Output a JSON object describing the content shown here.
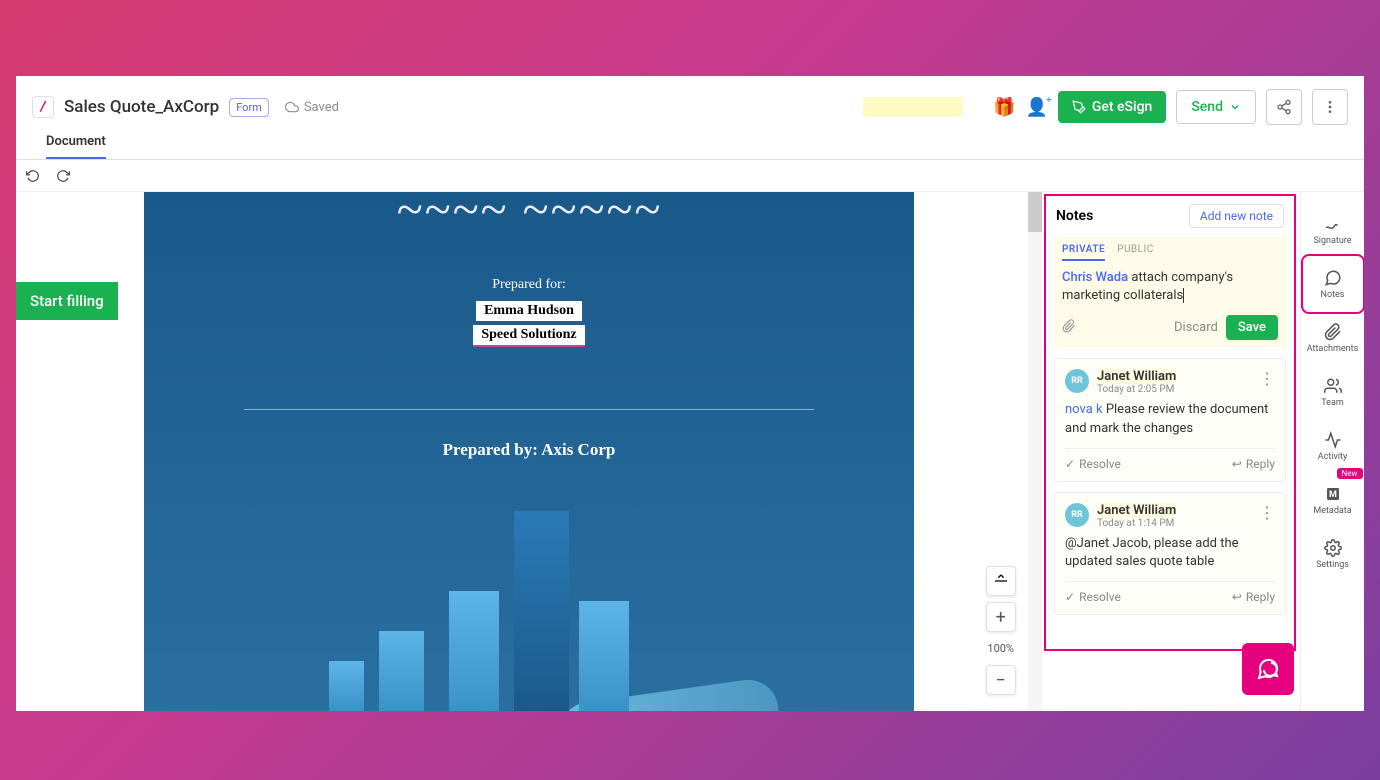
{
  "header": {
    "doc_title": "Sales Quote_AxCorp",
    "form_badge": "Form",
    "saved_label": "Saved",
    "get_esign": "Get eSign",
    "send": "Send"
  },
  "tabs": {
    "document": "Document"
  },
  "start_filling": "Start filling",
  "document": {
    "title_script": "Sales Quote",
    "prepared_for_label": "Prepared for:",
    "recipient_name": "Emma Hudson",
    "recipient_company": "Speed Solutionz",
    "prepared_by": "Prepared by: Axis Corp"
  },
  "zoom": {
    "percent": "100%"
  },
  "notes_panel": {
    "title": "Notes",
    "add_btn": "Add new note",
    "compose": {
      "tab_private": "PRIVATE",
      "tab_public": "PUBLIC",
      "mention": "Chris Wada",
      "text": " attach company's marketing collaterals",
      "discard": "Discard",
      "save": "Save"
    },
    "notes": [
      {
        "avatar": "RR",
        "author": "Janet William",
        "time": "Today at 2:05 PM",
        "mention": "nova k",
        "body": " Please review the document and mark the changes",
        "resolve": "Resolve",
        "reply": "Reply"
      },
      {
        "avatar": "RR",
        "author": "Janet William",
        "time": "Today at 1:14 PM",
        "mention": "",
        "body": "@Janet Jacob, please add the updated sales quote table",
        "resolve": "Resolve",
        "reply": "Reply"
      }
    ]
  },
  "rail": {
    "signature": "Signature",
    "notes": "Notes",
    "attachments": "Attachments",
    "team": "Team",
    "activity": "Activity",
    "metadata": "Metadata",
    "metadata_badge": "New",
    "settings": "Settings"
  }
}
